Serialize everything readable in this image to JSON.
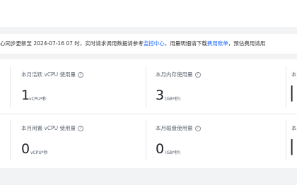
{
  "notice": {
    "prefix": "心同步更新至 2024-07-16 07 时，实时请求调用数据请参考",
    "link1": "监控中心",
    "middle": "，用量明细请下载",
    "link2": "费用账单",
    "suffix": "，预估费用请用"
  },
  "cards": [
    {
      "label": "本月活跃 vCPU 使用量",
      "value": "1",
      "unit": "vCPU*秒"
    },
    {
      "label": "本月内存使用量",
      "value": "3",
      "unit": "(GB*秒)"
    },
    {
      "label": "本",
      "value": "",
      "unit": ""
    },
    {
      "label": "本月闲置 vCPU 使用量",
      "value": "0",
      "unit": "vCPU*秒"
    },
    {
      "label": "本月磁盘使用量",
      "value": "0",
      "unit": "(GB*秒)"
    },
    {
      "label": "本",
      "value": "",
      "unit": ""
    }
  ],
  "help_icon": "question-circle-icon",
  "colors": {
    "link": "#1a66ff",
    "value": "#1d2129",
    "label": "#5c6470"
  }
}
